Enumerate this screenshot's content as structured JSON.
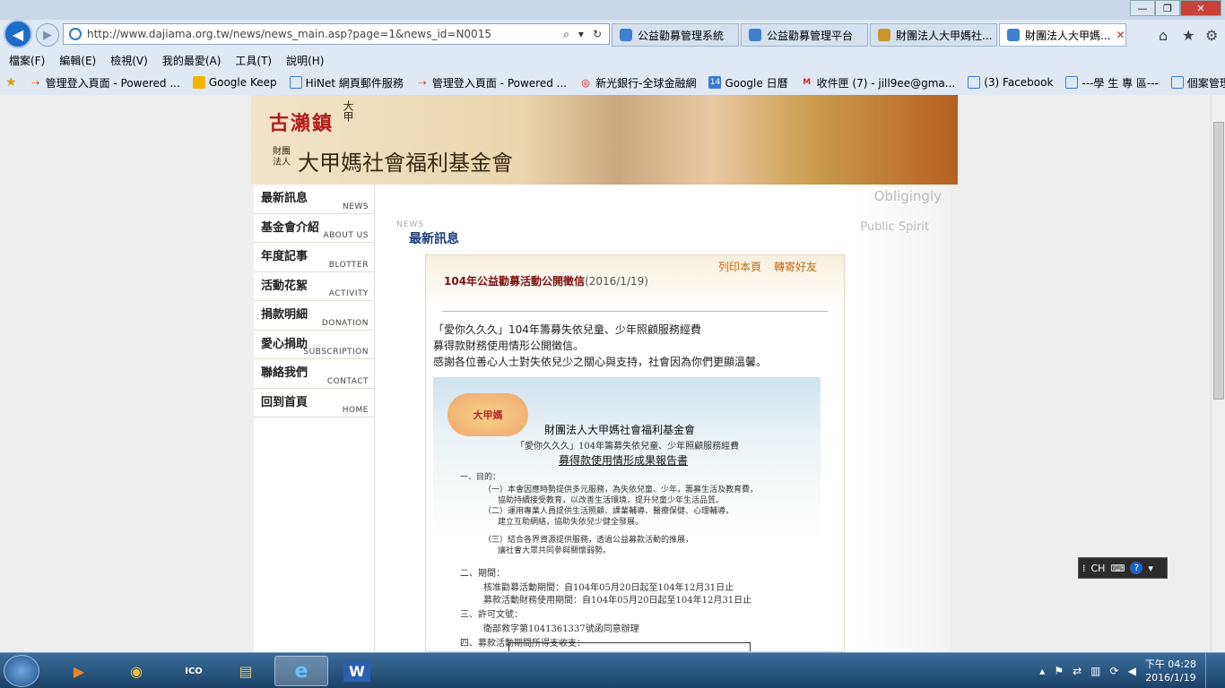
{
  "browser": {
    "url": "http://www.dajiama.org.tw/news/news_main.asp?page=1&news_id=N0015",
    "tabs": [
      {
        "label": "公益勸募管理系統",
        "active": false
      },
      {
        "label": "公益勸募管理平台",
        "active": false
      },
      {
        "label": "財團法人大甲媽社...",
        "active": false
      },
      {
        "label": "財團法人大甲媽...",
        "active": true
      }
    ],
    "close_glyph": "✕",
    "window_controls": [
      "—",
      "❐",
      "✕"
    ],
    "right_icons": [
      "⌂",
      "★",
      "⚙"
    ],
    "menu": [
      "檔案(F)",
      "編輯(E)",
      "檢視(V)",
      "我的最愛(A)",
      "工具(T)",
      "說明(H)"
    ],
    "favorites": [
      {
        "label": "管理登入頁面 - Powered ...",
        "icon": "double-arrow-icon",
        "color": "#e05a0c"
      },
      {
        "label": "Google Keep",
        "icon": "keep-icon",
        "color": "#f4b400"
      },
      {
        "label": "HiNet 網頁郵件服務",
        "icon": "ie-page-icon",
        "color": "#3a7bd5"
      },
      {
        "label": "管理登入頁面 - Powered ...",
        "icon": "double-arrow-icon",
        "color": "#e05a0c"
      },
      {
        "label": "新光銀行-全球金融網",
        "icon": "skbank-icon",
        "color": "#d0101a"
      },
      {
        "label": "Google 日曆",
        "icon": "calendar-icon",
        "color": "#3a78d8"
      },
      {
        "label": "收件匣 (7) - jill9ee@gma...",
        "icon": "gmail-icon",
        "color": "#d93025"
      },
      {
        "label": "(3) Facebook",
        "icon": "ie-page-icon",
        "color": "#3a7bd5"
      },
      {
        "label": "---學 生 專 區---",
        "icon": "ie-page-icon",
        "color": "#3a7bd5"
      },
      {
        "label": "個案管理系統",
        "icon": "ie-page-icon",
        "color": "#3a7bd5"
      }
    ]
  },
  "site": {
    "logo_small": "古瀨鎮",
    "logo_small_tag": "大甲",
    "logo_main": "大甲媽社會福利基金會",
    "logo_prefix": "財團 法人",
    "nav": [
      {
        "zh": "最新訊息",
        "en": "NEWS"
      },
      {
        "zh": "基金會介紹",
        "en": "ABOUT US"
      },
      {
        "zh": "年度記事",
        "en": "BLOTTER"
      },
      {
        "zh": "活動花絮",
        "en": "ACTIVITY"
      },
      {
        "zh": "捐款明細",
        "en": "DONATION"
      },
      {
        "zh": "愛心捐助",
        "en": "SUBSCRIPTION"
      },
      {
        "zh": "聯絡我們",
        "en": "CONTACT"
      },
      {
        "zh": "回到首頁",
        "en": "HOME"
      }
    ],
    "slogan_1": "Obligingly",
    "slogan_2": "Public Spirit",
    "section_small": "NEWS",
    "section_title": "最新訊息",
    "print_button": "列印本頁",
    "share_button": "轉寄好友",
    "article": {
      "title": "104年公益勸募活動公開徵信",
      "date": "(2016/1/19)",
      "lines": [
        "「愛你久久久」104年籌募失依兒童、少年照顧服務經費",
        "募得款財務使用情形公開徵信。",
        "感謝各位善心人士對失依兒少之關心與支持，社會因為你們更顯溫馨。"
      ]
    },
    "report": {
      "logo_text": "大甲媽",
      "org": "財團法人大甲媽社會福利基金會",
      "subtitle": "「愛你久久久」104年籌募失依兒童、少年照顧服務經費",
      "heading": "募得款使用情形成果報告書",
      "body": [
        "一、目的：",
        "（一）本會因應時勢提供多元服務，為失依兒童、少年，籌募生活及教育費，",
        "協助持續接受教育，以改善生活環境，提升兒童少年生活品質。",
        "（二）運用專業人員提供生活照顧、課業輔導、醫療保健、心理輔導，",
        "建立互助網絡，協助失依兒少健全發展。",
        "（三）結合各界資源提供服務，透過公益募款活動的推展，",
        "讓社會大眾共同參與關懷弱勢。",
        "二、期間：",
        "核准勸募活動期間：自104年05月20日起至104年12月31日止",
        "募款活動財務使用期間：自104年05月20日起至104年12月31日止",
        "三、許可文號：",
        "衛部救字第1041361337號函同意辦理",
        "四、募款活動期間所得支收支："
      ]
    }
  },
  "taskbar": {
    "apps": [
      {
        "name": "media-icon",
        "glyph": "▶",
        "color": "#e8862a"
      },
      {
        "name": "chrome-icon",
        "glyph": "◉",
        "color": "#d8372b"
      },
      {
        "name": "ico-app-icon",
        "glyph": "ICO",
        "color": "#5a8fc9"
      },
      {
        "name": "folder-icon",
        "glyph": "▤",
        "color": "#e8c35a"
      },
      {
        "name": "ie-icon",
        "glyph": "e",
        "color": "#3a88d8"
      },
      {
        "name": "word-icon",
        "glyph": "W",
        "color": "#2b5faf"
      }
    ],
    "ime_label": "CH",
    "clock_time": "下午 04:28",
    "clock_date": "2016/1/19"
  }
}
